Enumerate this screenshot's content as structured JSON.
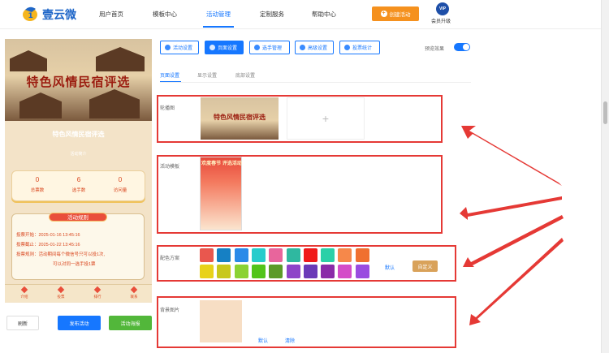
{
  "nav": {
    "logo_text": "壹云微",
    "items": [
      "用户首页",
      "模板中心",
      "活动管理",
      "定制服务",
      "帮助中心"
    ],
    "create_label": "创建活动",
    "vip_badge": "VIP",
    "vip_label": "会员升级"
  },
  "preview": {
    "hero_title": "特色风情民宿评选",
    "name": "特色风情民宿评选",
    "subtitle": "活动简介",
    "stats": [
      {
        "value": "0",
        "label": "总票数"
      },
      {
        "value": "6",
        "label": "选手数"
      },
      {
        "value": "0",
        "label": "访问量"
      }
    ],
    "rules_title": "活动规则",
    "rules": [
      "投票开始：2025-01-16 13:45:16",
      "投票截止：2025-01-22 13:45:16",
      "投票规则：活动期间每个微信号只可以投1次,",
      "可以对同一选手投1票"
    ],
    "tabs": [
      "介绍",
      "投票",
      "排行",
      "联系"
    ]
  },
  "left_buttons": {
    "refresh": "刷新",
    "publish": "发布活动",
    "poster": "活动海报"
  },
  "toolbar": {
    "buttons": [
      "活动设置",
      "页面设置",
      "选手管理",
      "高级设置",
      "投票统计"
    ],
    "preview_label": "预览效果"
  },
  "subtabs": [
    "页面设置",
    "显示设置",
    "底部设置"
  ],
  "sections": {
    "carousel_label": "轮播图",
    "carousel_thumb_text": "特色风情民宿评选",
    "add_symbol": "+",
    "template_label": "活动模板",
    "template_thumb_text": "欢度春节 评选活动",
    "color_label": "配色方案",
    "color_default": "默认",
    "color_custom": "自定义",
    "bg_label": "背景图片",
    "bg_default": "默认",
    "bg_clear": "清除"
  },
  "colors": {
    "accent": "#1677ff",
    "orange": "#f5911e",
    "red_box": "#e53935",
    "swatches_row1": [
      "#e9574e",
      "#1680c4",
      "#2a8ae8",
      "#27cccc",
      "#e8659c",
      "#2fb8a0",
      "#f01a1a",
      "#2bd0a8",
      "#f6884a",
      "#f07030"
    ],
    "swatches_row2": [
      "#e8d21a",
      "#c8c81c",
      "#8ad234",
      "#52c41a",
      "#5c9a28",
      "#8e44c8",
      "#6a3ab8",
      "#8a2aa8",
      "#d44cc8",
      "#9a4ce0"
    ]
  }
}
